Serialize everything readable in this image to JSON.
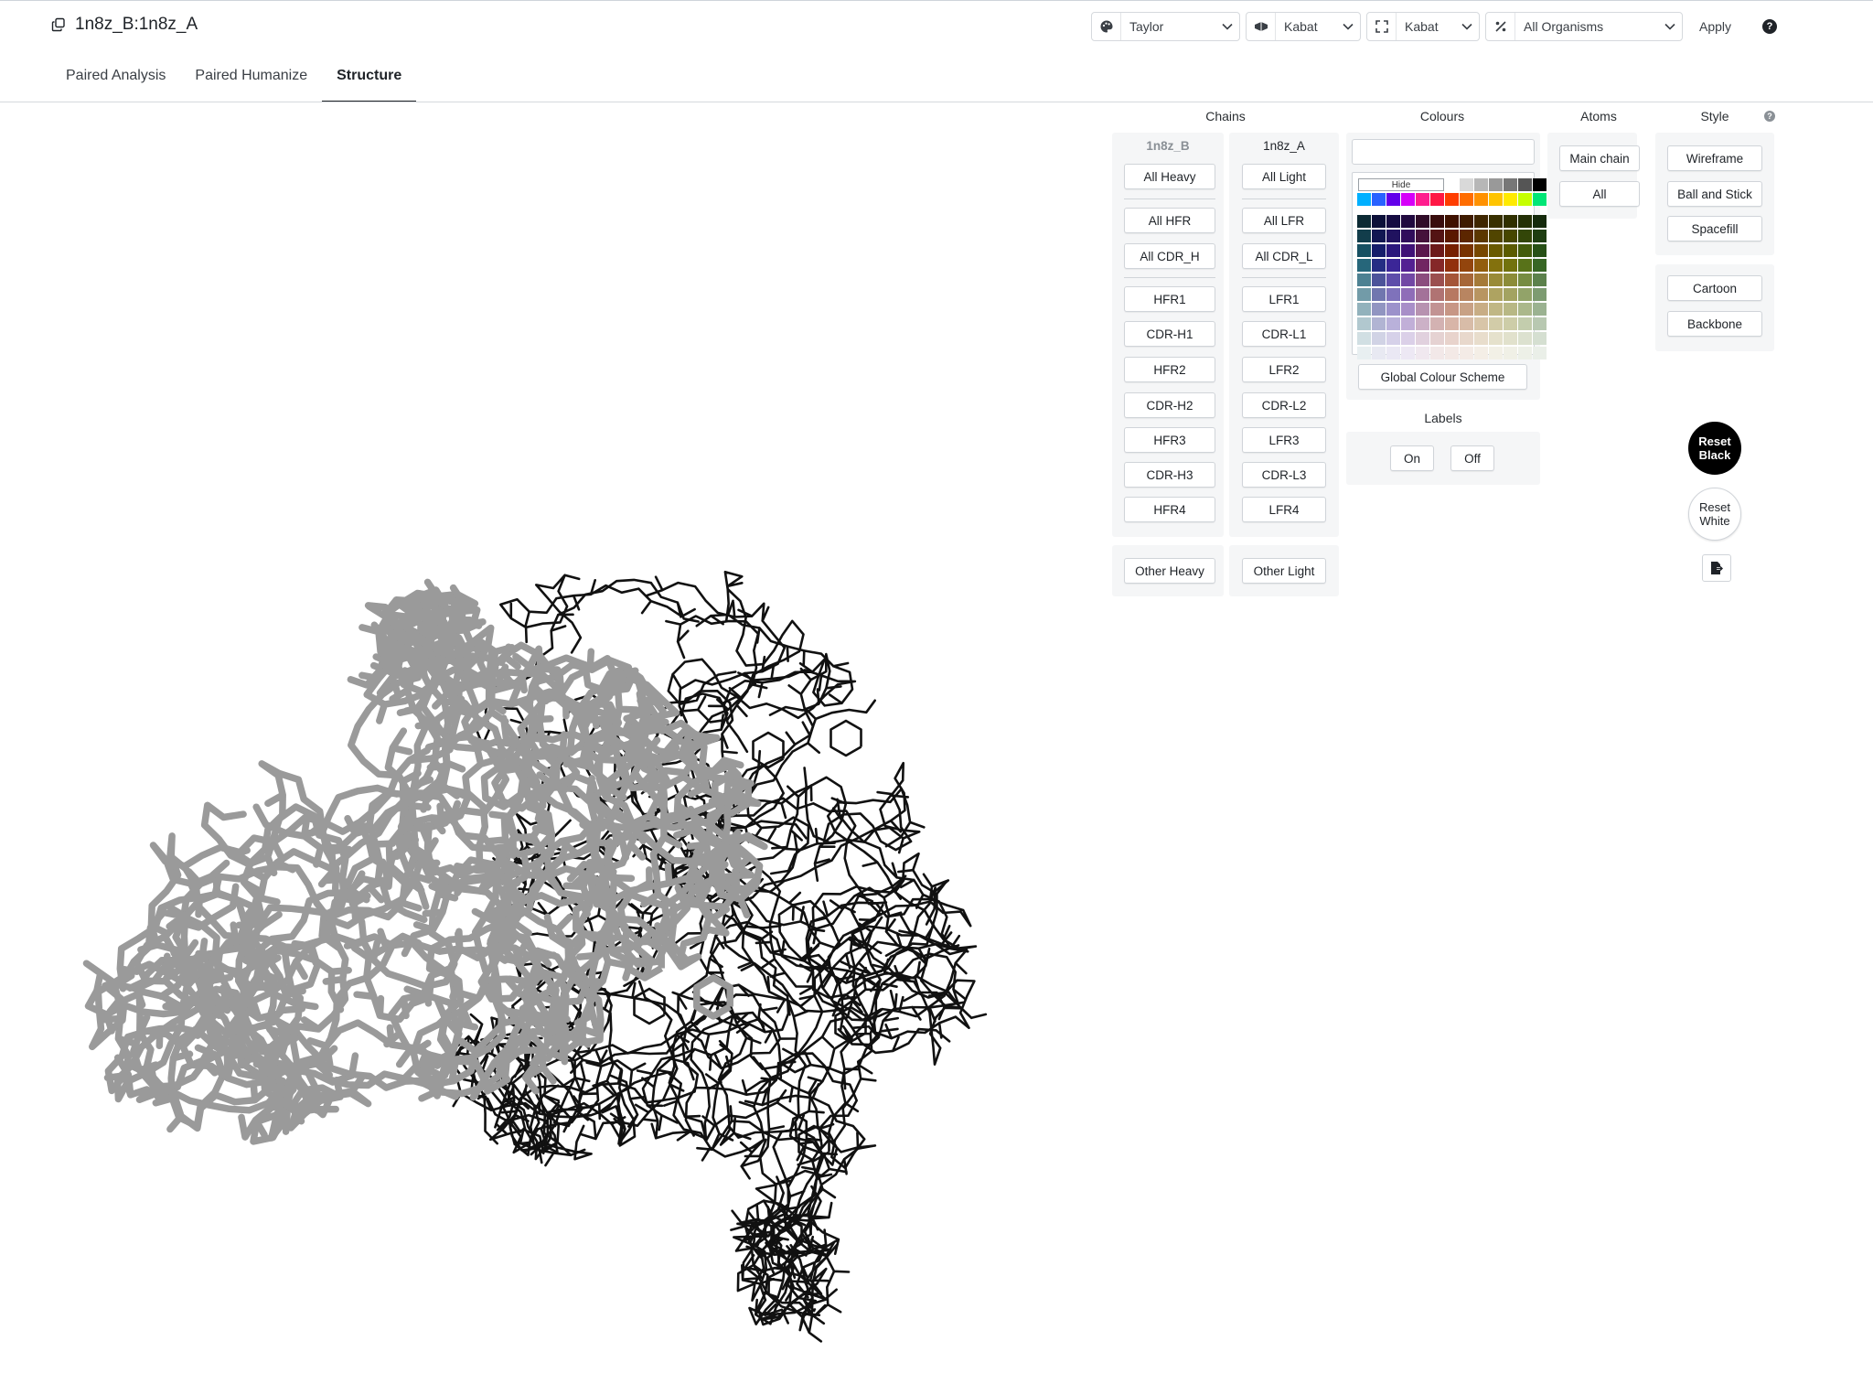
{
  "header": {
    "title": "1n8z_B:1n8z_A",
    "selects": [
      {
        "icon": "palette-icon",
        "value": "Taylor"
      },
      {
        "icon": "numbering-icon",
        "value": "Kabat"
      },
      {
        "icon": "expand-icon",
        "value": "Kabat"
      },
      {
        "icon": "percent-icon",
        "value": "All Organisms"
      }
    ],
    "apply_label": "Apply",
    "help_label": "?"
  },
  "tabs": [
    "Paired Analysis",
    "Paired Humanize",
    "Structure"
  ],
  "active_tab": "Structure",
  "panel": {
    "headings": {
      "chains": "Chains",
      "colours": "Colours",
      "atoms": "Atoms",
      "style": "Style"
    },
    "chain_b": {
      "name": "1n8z_B",
      "all": "All Heavy",
      "groups": [
        "All HFR",
        "All CDR_H"
      ],
      "regions": [
        "HFR1",
        "CDR-H1",
        "HFR2",
        "CDR-H2",
        "HFR3",
        "CDR-H3",
        "HFR4"
      ],
      "other": "Other Heavy"
    },
    "chain_a": {
      "name": "1n8z_A",
      "all": "All Light",
      "groups": [
        "All LFR",
        "All CDR_L"
      ],
      "regions": [
        "LFR1",
        "CDR-L1",
        "LFR2",
        "CDR-L2",
        "LFR3",
        "CDR-L3",
        "LFR4"
      ],
      "other": "Other Light"
    },
    "colours": {
      "hide_label": "Hide",
      "global_scheme": "Global Colour Scheme",
      "labels_heading": "Labels",
      "labels_on": "On",
      "labels_off": "Off",
      "gray_row": [
        "#ffffff",
        "#d9d9d9",
        "#b7b7b7",
        "#999999",
        "#777777",
        "#555555",
        "#000000"
      ],
      "bright_row": [
        "#00b0ff",
        "#2962ff",
        "#6200ea",
        "#d500f9",
        "#ff1d8e",
        "#ff1744",
        "#ff3d00",
        "#ff6d00",
        "#ff9100",
        "#ffc400",
        "#ffea00",
        "#c6ff00",
        "#00e676"
      ],
      "hues": [
        "#1b5e73",
        "#1a237e",
        "#311b92",
        "#4a148c",
        "#6a1b5a",
        "#7f1d1d",
        "#8b2500",
        "#8d3b00",
        "#8c5400",
        "#7c6a00",
        "#6b6b00",
        "#4f6b0d",
        "#2e5e1a"
      ]
    },
    "atoms": {
      "main_chain": "Main chain",
      "all": "All"
    },
    "style": {
      "wireframe": "Wireframe",
      "ball_and_stick": "Ball and Stick",
      "spacefill": "Spacefill",
      "cartoon": "Cartoon",
      "backbone": "Backbone"
    },
    "reset_black": "Reset Black",
    "reset_white": "Reset White",
    "help_label": "?"
  }
}
